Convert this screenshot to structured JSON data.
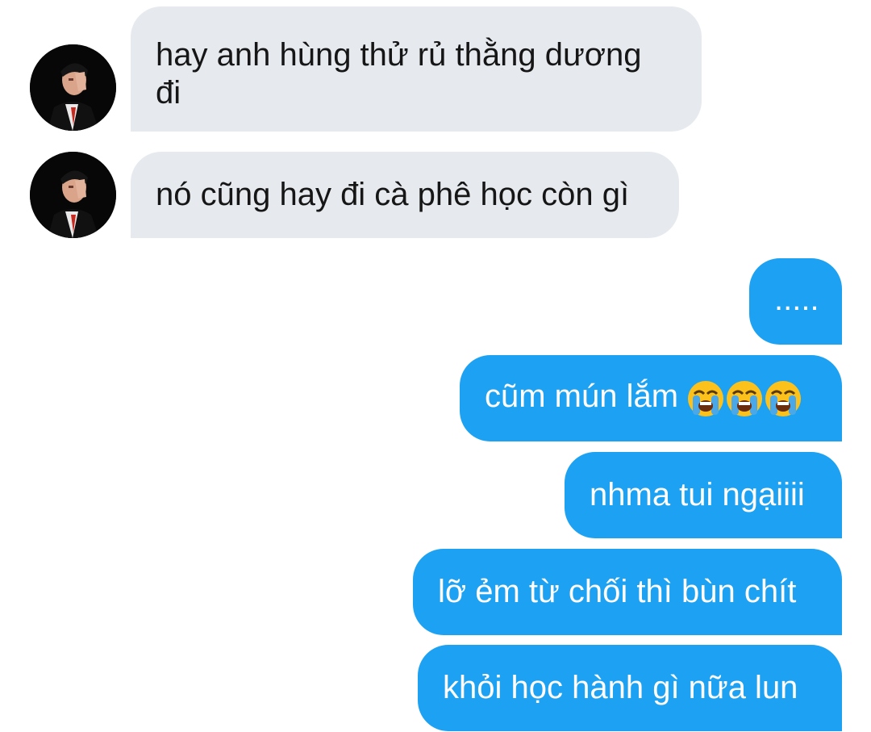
{
  "thread": {
    "incoming": [
      {
        "text": "hay anh hùng thử rủ thằng dương đi",
        "line1": "hay anh hùng thử rủ thằng dương",
        "line2": "đi"
      },
      {
        "text": "nó cũng hay đi cà phê học còn gì"
      }
    ],
    "outgoing": [
      {
        "text": "....."
      },
      {
        "text": "cũm mún lắm",
        "emoji": "loudly-crying-face",
        "emoji_count": 3
      },
      {
        "text": "nhma tui ngạiiii"
      },
      {
        "text": "lỡ ẻm từ chối thì bùn chít"
      },
      {
        "text": "khỏi học hành gì nữa lun"
      }
    ]
  },
  "colors": {
    "incoming_bubble": "#e6eaee",
    "outgoing_bubble": "#1da1f2",
    "incoming_text": "#161616",
    "outgoing_text": "#ffffff",
    "background": "#ffffff"
  }
}
